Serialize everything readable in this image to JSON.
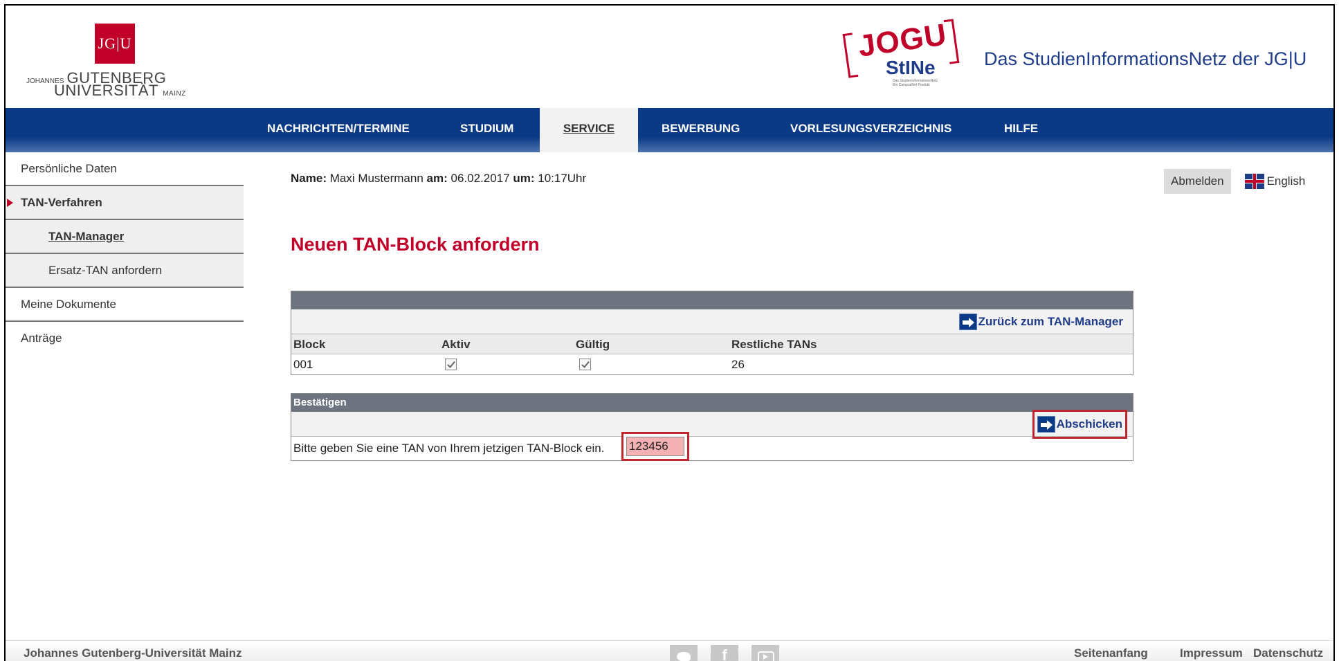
{
  "header": {
    "jgu_logo": {
      "mark": "JG|U",
      "line1_small": "JOHANNES",
      "line1": "GUTENBERG",
      "line2": "UNIVERSITÄT",
      "line2_small": "MAINZ"
    },
    "stine_logo": {
      "jogu": "JOGU",
      "stine": "StINe",
      "sub1": "Das StudienInformationsNetz",
      "sub2": "Ein CampusNet Produkt"
    },
    "tagline": "Das StudienInformationsNetz der JG|U"
  },
  "nav": {
    "items": [
      {
        "label": "NACHRICHTEN/TERMINE"
      },
      {
        "label": "STUDIUM"
      },
      {
        "label": "SERVICE",
        "active": true
      },
      {
        "label": "BEWERBUNG"
      },
      {
        "label": "VORLESUNGSVERZEICHNIS"
      },
      {
        "label": "HILFE"
      }
    ]
  },
  "sidebar": {
    "items": [
      {
        "label": "Persönliche Daten"
      },
      {
        "label": "TAN-Verfahren",
        "selected": true
      },
      {
        "label": "TAN-Manager"
      },
      {
        "label": "Ersatz-TAN anfordern"
      },
      {
        "label": "Meine Dokumente"
      },
      {
        "label": "Anträge"
      }
    ]
  },
  "session": {
    "name_label": "Name",
    "name_value": "Maxi Mustermann",
    "date_label": "am",
    "date_value": "06.02.2017",
    "time_label": "um",
    "time_value": "10:17Uhr",
    "logout_label": "Abmelden",
    "language_label": "English"
  },
  "main": {
    "title": "Neuen TAN-Block anfordern",
    "back_link": "Zurück zum TAN-Manager",
    "table": {
      "columns": [
        "Block",
        "Aktiv",
        "Gültig",
        "Restliche TANs"
      ],
      "rows": [
        {
          "block": "001",
          "aktiv": true,
          "gueltig": true,
          "restliche": "26"
        }
      ]
    },
    "confirm": {
      "heading": "Bestätigen",
      "submit_label": "Abschicken",
      "prompt": "Bitte geben Sie eine TAN von Ihrem jetzigen TAN-Block ein.",
      "tan_value": "123456"
    }
  },
  "footer": {
    "university": "Johannes Gutenberg-Universität Mainz",
    "links": [
      "Seitenanfang",
      "Impressum",
      "Datenschutz"
    ],
    "social": [
      "twitter-icon",
      "facebook-icon",
      "youtube-icon"
    ]
  },
  "colors": {
    "brand_red": "#c1002a",
    "nav_blue": "#0a3a86",
    "panel_gray": "#6d7480",
    "highlight_red": "#c0262d",
    "tan_fill": "#f4b2b5"
  }
}
